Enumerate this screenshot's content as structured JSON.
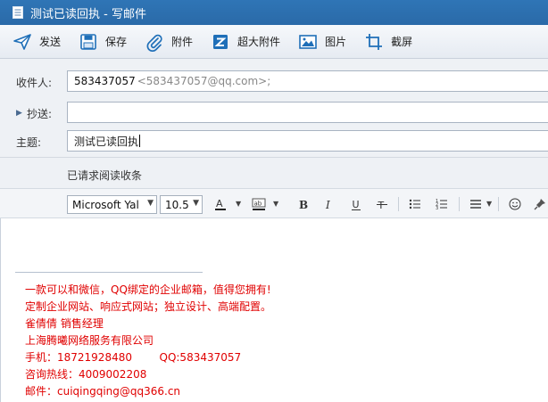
{
  "window": {
    "title": "测试已读回执 - 写邮件",
    "icon": "document-icon"
  },
  "toolbar": {
    "send": "发送",
    "save": "保存",
    "attach": "附件",
    "big_attach": "超大附件",
    "picture": "图片",
    "screenshot": "截屏"
  },
  "form": {
    "to_label": "收件人:",
    "to_value": "583437057",
    "to_address": "<583437057@qq.com>;",
    "cc_label": "抄送:",
    "cc_value": "",
    "subject_label": "主题:",
    "subject_value": "测试已读回执",
    "read_receipt": "已请求阅读收条"
  },
  "format": {
    "font_family": "Microsoft Yal",
    "font_size": "10.5",
    "text_color_glyph": "A",
    "bg_color_glyph": "ab",
    "bold": "B",
    "italic": "I",
    "underline": "U",
    "strike": "T"
  },
  "signature": {
    "line1": "一款可以和微信，QQ绑定的企业邮箱，值得您拥有!",
    "line2": "定制企业网站、响应式网站；独立设计、高端配置。",
    "line3": "雀倩倩  销售经理",
    "line4": "上海腾曦网络服务有限公司",
    "line5": "手机：18721928480        QQ:583437057",
    "line6": "咨询热线：4009002208",
    "line7": "邮件：cuiqingqing@qq366.cn"
  },
  "colors": {
    "titlebar": "#2f75b6",
    "signature_text": "#e00000",
    "toolbar_icon": "#1f6fb8"
  }
}
